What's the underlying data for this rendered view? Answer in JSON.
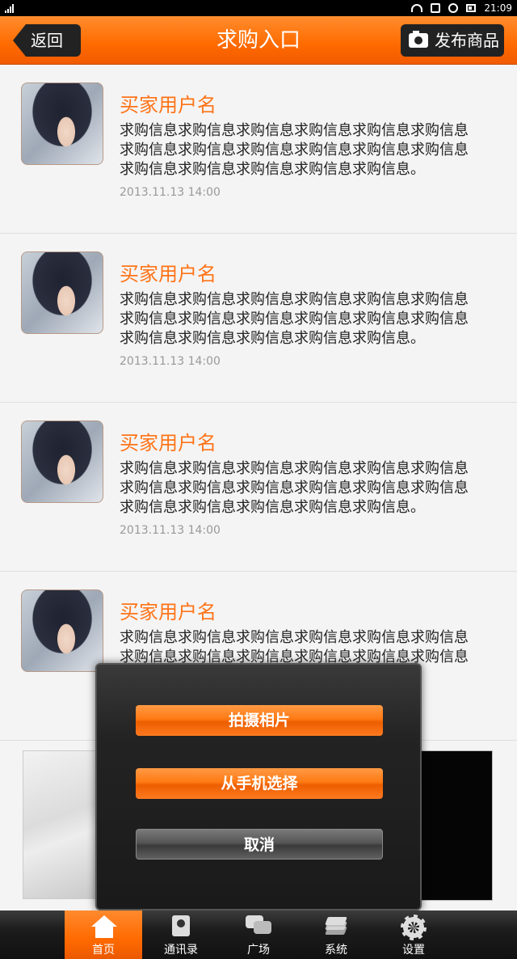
{
  "status_bar": {
    "time": "21:09"
  },
  "header": {
    "back_label": "返回",
    "title": "求购入口",
    "publish_label": "发布商品"
  },
  "items": [
    {
      "name": "买家用户名",
      "desc": "求购信息求购信息求购信息求购信息求购信息求购信息求购信息求购信息求购信息求购信息求购信息求购信息求购信息求购信息求购信息求购信息求购信息。",
      "time": "2013.11.13 14:00"
    },
    {
      "name": "买家用户名",
      "desc": "求购信息求购信息求购信息求购信息求购信息求购信息求购信息求购信息求购信息求购信息求购信息求购信息求购信息求购信息求购信息求购信息求购信息。",
      "time": "2013.11.13 14:00"
    },
    {
      "name": "买家用户名",
      "desc": "求购信息求购信息求购信息求购信息求购信息求购信息求购信息求购信息求购信息求购信息求购信息求购信息求购信息求购信息求购信息求购信息求购信息。",
      "time": "2013.11.13 14:00"
    },
    {
      "name": "买家用户名",
      "desc": "求购信息求购信息求购信息求购信息求购信息求购信息求购信息求购信息求购信息求购信息求购信息求购信息",
      "time": ""
    }
  ],
  "popup": {
    "take_photo": "拍摄相片",
    "choose_from_phone": "从手机选择",
    "cancel": "取消"
  },
  "tabs": [
    {
      "label": "首页",
      "icon": "home-icon",
      "active": true
    },
    {
      "label": "通讯录",
      "icon": "contacts-icon",
      "active": false
    },
    {
      "label": "广场",
      "icon": "chat-icon",
      "active": false
    },
    {
      "label": "系统",
      "icon": "layers-icon",
      "active": false
    },
    {
      "label": "设置",
      "icon": "gear-icon",
      "active": false
    }
  ],
  "colors": {
    "accent": "#ff6a00",
    "username": "#ff7418"
  }
}
